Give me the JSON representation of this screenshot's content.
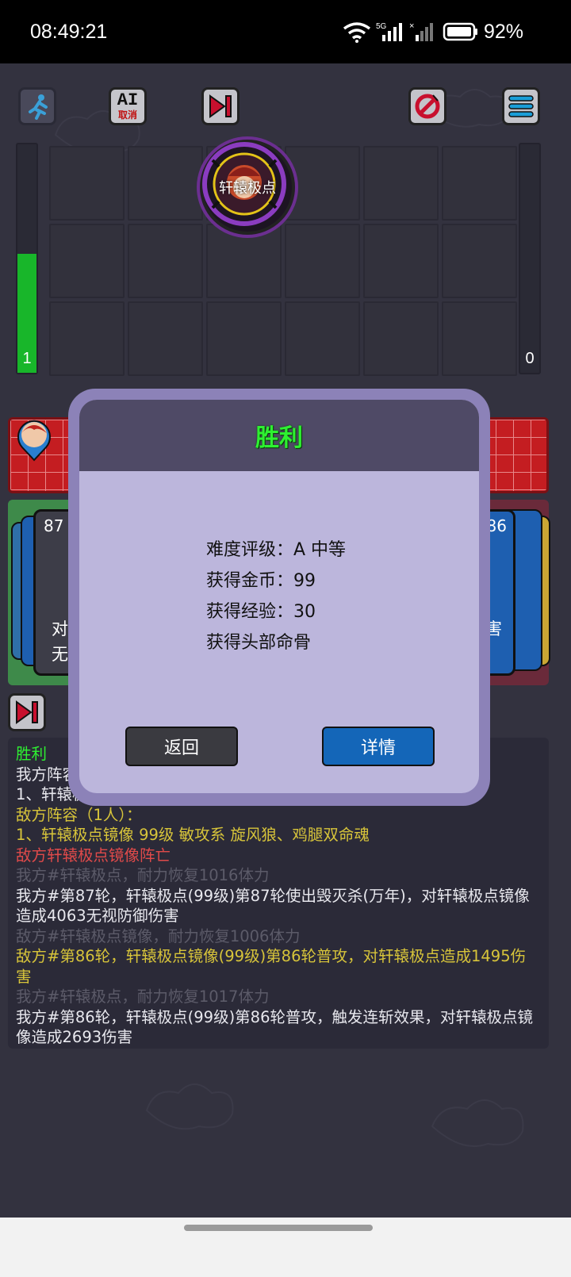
{
  "status_bar": {
    "time": "08:49:21",
    "battery": "92%"
  },
  "top_bar": {
    "ai_label_top": "AI",
    "ai_label_bottom": "取消"
  },
  "gauges": {
    "left_value": "1",
    "left_fill": 0.52,
    "right_value": "0"
  },
  "board": {
    "token_name": "轩辕极点"
  },
  "cards": {
    "left_number": "87",
    "left_text": "对\n无",
    "right_number": "86",
    "right_text": "害"
  },
  "dialog": {
    "title": "胜利",
    "lines": [
      "难度评级：A 中等",
      "获得金币：99",
      "获得经验：30",
      "获得头部命骨"
    ],
    "back_label": "返回",
    "details_label": "详情"
  },
  "colors": {
    "victory_green": "#2ef031",
    "enemy_yellow": "#d7c43a",
    "death_red": "#e04a4a",
    "muted_gray": "#5c5b69",
    "white": "#e8e8ee",
    "details_blue": "#1466b8"
  },
  "battle_log": [
    {
      "text": "胜利",
      "color": "#2ef031"
    },
    {
      "text": "我方阵容（1人）：",
      "color": "#e8e8ee"
    },
    {
      "text": "1、轩辕极点 99级 敏攻系 旋风狼、鸡腿双命魂",
      "color": "#e8e8ee"
    },
    {
      "text": "敌方阵容（1人）：",
      "color": "#d7c43a"
    },
    {
      "text": "1、轩辕极点镜像 99级 敏攻系 旋风狼、鸡腿双命魂",
      "color": "#d7c43a"
    },
    {
      "text": "敌方轩辕极点镜像阵亡",
      "color": "#e04a4a"
    },
    {
      "text": "我方#轩辕极点，耐力恢复1016体力",
      "color": "#5c5b69"
    },
    {
      "text": "我方#第87轮，轩辕极点(99级)第87轮使出毁灭杀(万年)，对轩辕极点镜像造成4063无视防御伤害",
      "color": "#e8e8ee"
    },
    {
      "text": "敌方#轩辕极点镜像，耐力恢复1006体力",
      "color": "#5c5b69"
    },
    {
      "text": "敌方#第86轮，轩辕极点镜像(99级)第86轮普攻，对轩辕极点造成1495伤害",
      "color": "#d7c43a"
    },
    {
      "text": "我方#轩辕极点，耐力恢复1017体力",
      "color": "#5c5b69"
    },
    {
      "text": "我方#第86轮，轩辕极点(99级)第86轮普攻，触发连斩效果，对轩辕极点镜像造成2693伤害",
      "color": "#e8e8ee"
    }
  ]
}
